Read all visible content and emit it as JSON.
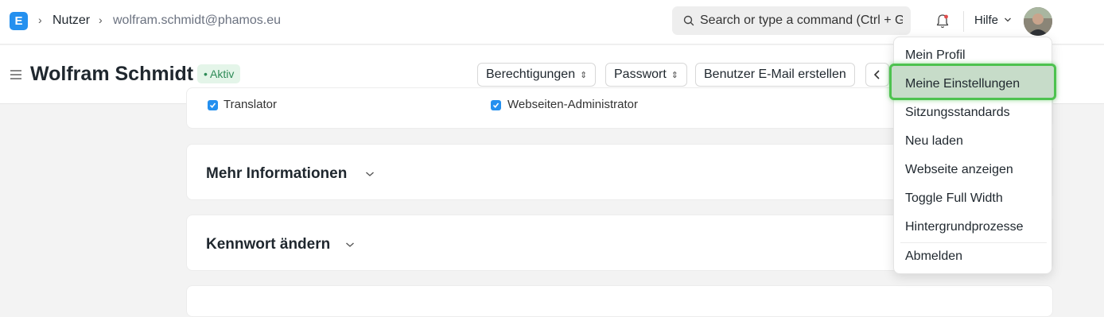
{
  "navbar": {
    "logo_letter": "E",
    "breadcrumb": [
      "Nutzer",
      "wolfram.schmidt@phamos.eu"
    ],
    "search_placeholder": "Search or type a command (Ctrl + G)",
    "help_label": "Hilfe"
  },
  "page": {
    "title": "Wolfram Schmidt",
    "status": "Aktiv",
    "buttons": [
      "Berechtigungen",
      "Passwort",
      "Benutzer E-Mail erstellen"
    ]
  },
  "roles": [
    "Translator",
    "Webseiten-Administrator"
  ],
  "sections": [
    "Mehr Informationen",
    "Kennwort ändern"
  ],
  "user_menu": {
    "items": [
      "Mein Profil",
      "Meine Einstellungen",
      "Sitzungsstandards",
      "Neu laden",
      "Webseite anzeigen",
      "Toggle Full Width",
      "Hintergrundprozesse",
      "Abmelden"
    ],
    "highlighted_index": 1
  },
  "colors": {
    "brand": "#2490ef",
    "status_green": "#2e8b57",
    "highlight_border": "#4dc24f"
  }
}
